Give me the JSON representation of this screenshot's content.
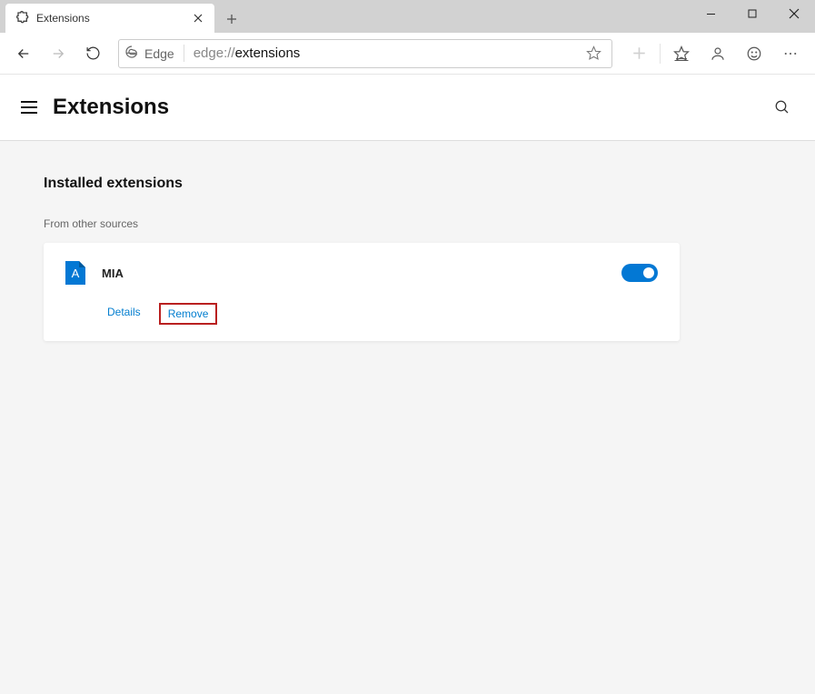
{
  "tab": {
    "title": "Extensions"
  },
  "addressbar": {
    "brand": "Edge",
    "protocol": "edge://",
    "path": "extensions"
  },
  "page": {
    "title": "Extensions",
    "section_title": "Installed extensions",
    "source_label": "From other sources"
  },
  "extension": {
    "icon_letter": "A",
    "name": "MIA",
    "details_label": "Details",
    "remove_label": "Remove"
  }
}
